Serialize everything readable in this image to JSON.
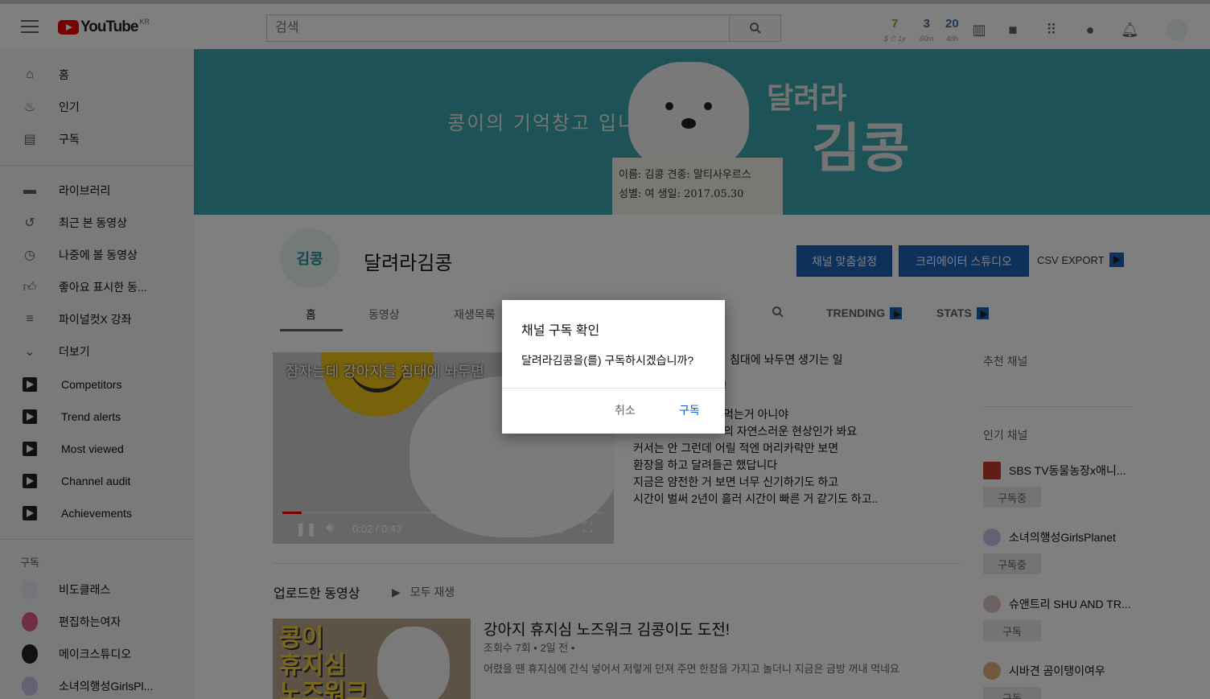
{
  "header": {
    "logo_text": "YouTube",
    "country": "KR",
    "search_placeholder": "검색",
    "stats": [
      {
        "value": "7",
        "label": "$ ⏱ 1y",
        "color": "#b59a12"
      },
      {
        "value": "3",
        "label": "60m",
        "color": "#3a6ea5"
      },
      {
        "value": "20",
        "label": "48h",
        "color": "#3a6ea5"
      }
    ]
  },
  "sidebar": {
    "main": [
      {
        "label": "홈",
        "icon": "home-icon"
      },
      {
        "label": "인기",
        "icon": "fire-icon"
      },
      {
        "label": "구독",
        "icon": "subscriptions-icon"
      }
    ],
    "library": [
      {
        "label": "라이브러리",
        "icon": "folder-icon"
      },
      {
        "label": "최근 본 동영상",
        "icon": "history-icon"
      },
      {
        "label": "나중에 볼 동영상",
        "icon": "clock-icon"
      },
      {
        "label": "좋아요 표시한 동...",
        "icon": "thumbs-up-icon"
      },
      {
        "label": "파이널컷X 강좌",
        "icon": "playlist-icon"
      },
      {
        "label": "더보기",
        "icon": "chevron-down-icon"
      }
    ],
    "tools": [
      {
        "label": "Competitors"
      },
      {
        "label": "Trend alerts"
      },
      {
        "label": "Most viewed"
      },
      {
        "label": "Channel audit"
      },
      {
        "label": "Achievements"
      }
    ],
    "subscriptions_heading": "구독",
    "subscriptions": [
      {
        "label": "비도클래스",
        "color": "#3b2f8f"
      },
      {
        "label": "편집하는여자",
        "color": "#e05a8a"
      },
      {
        "label": "메이크스튜디오",
        "color": "#222222"
      },
      {
        "label": "소녀의행성GirlsPl...",
        "color": "#c9c3e6"
      }
    ]
  },
  "banner": {
    "tagline": "콩이의 기억창고 입니다",
    "brand_small": "달려라",
    "brand_big": "김콩",
    "card_line1": "이름: 김콩   견종: 말티사우르스",
    "card_line2": "성별: 여    생일: 2017.05.30"
  },
  "channel": {
    "avatar_text": "김콩",
    "name": "달려라김콩",
    "customize_button": "채널 맞춤설정",
    "studio_button": "크리에이터 스튜디오",
    "csv_export": "CSV EXPORT"
  },
  "tabs": {
    "home": "홈",
    "videos": "동영상",
    "playlists": "재생목록",
    "trending": "TRENDING",
    "stats": "STATS"
  },
  "player": {
    "title": "잠자는데 강아지를 침대에 놔두면",
    "time": "0:02 / 0:43",
    "progress": 0.06
  },
  "featured_desc": [
    "침대에 놔두면 생기는 일",
    "!",
    "먹는거 아니야",
    "의 자연스러운 현상인가 봐요",
    "커서는 안 그런데 어릴 적엔 머리카락만 보면",
    "환장을 하고 달려들곤 했답니다",
    "지금은 얌전한 거 보면 너무 신기하기도 하고",
    "시간이 벌써 2년이 흘러 시간이 빠른 거 같기도 하고.."
  ],
  "right_panel": {
    "recommended_heading": "추천 채널",
    "popular_heading": "인기 채널",
    "channels": [
      {
        "name": "SBS TV동물농장x애니...",
        "button": "구독중",
        "color": "#c0392b"
      },
      {
        "name": "소녀의행성GirlsPlanet",
        "button": "구독중",
        "color": "#c9c3e6"
      },
      {
        "name": "슈앤트리 SHU AND TR...",
        "button": "구독",
        "color": "#d8c7c0"
      },
      {
        "name": "시바견 곰이탱이여우",
        "button": "구독",
        "color": "#e3b37a"
      }
    ]
  },
  "uploads": {
    "heading": "업로드한 동영상",
    "play_all": "모두 재생",
    "thumb_text": "콩이\n휴지심\n노즈워크",
    "video_title": "강아지 휴지심 노즈워크 김콩이도 도전!",
    "video_meta": "조회수 7회 • 2일 전 •",
    "video_desc": "어렸을 땐 휴지심에 간식 넣어서 저렇게 던져 주면 한참을 가지고 놀더니 지금은 금방 꺼내 먹네요"
  },
  "dialog": {
    "title": "채널 구독 확인",
    "message": "달려라김콩을(를) 구독하시겠습니까?",
    "cancel": "취소",
    "confirm": "구독"
  }
}
